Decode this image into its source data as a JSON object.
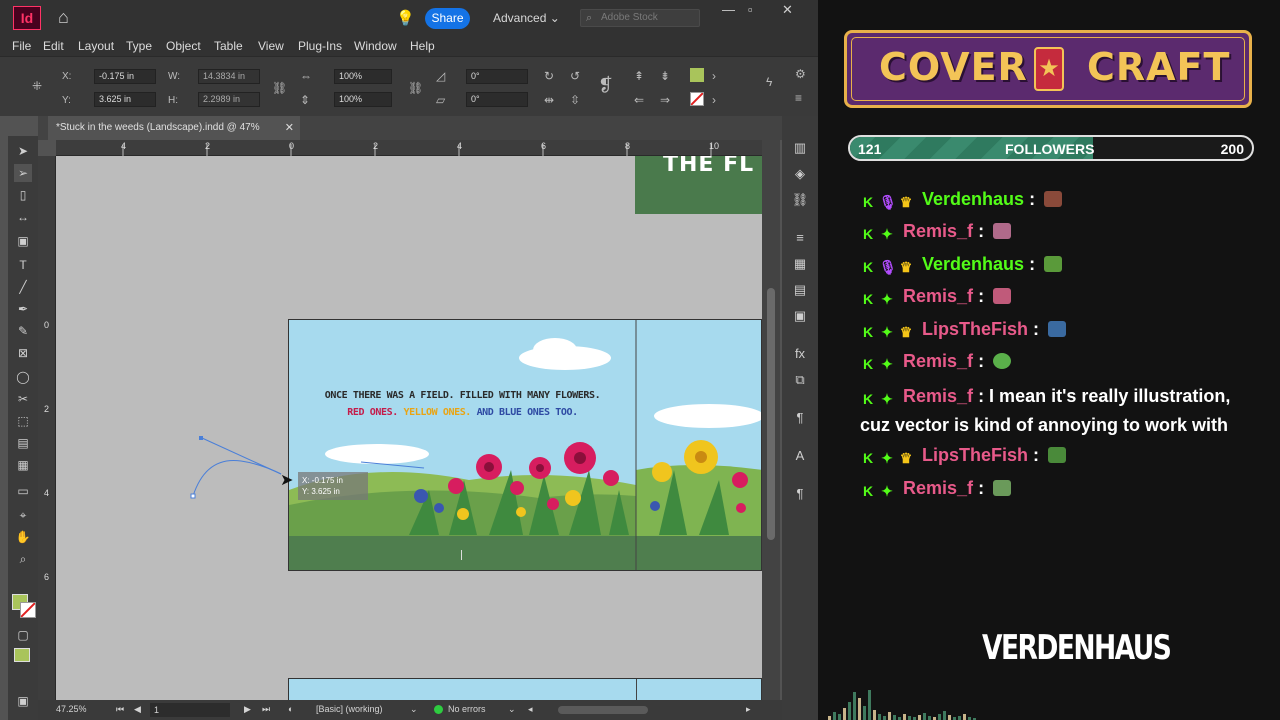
{
  "app": {
    "logo": "Id",
    "share_label": "Share",
    "workspace": "Advanced",
    "stock_placeholder": "Adobe Stock",
    "menu": [
      "File",
      "Edit",
      "Layout",
      "Type",
      "Object",
      "Table",
      "View",
      "Plug-Ins",
      "Window",
      "Help"
    ]
  },
  "control": {
    "x_label": "X:",
    "x_value": "-0.175 in",
    "y_label": "Y:",
    "y_value": "3.625 in",
    "w_label": "W:",
    "w_value": "14.3834 in",
    "h_label": "H:",
    "h_value": "2.2989 in",
    "scale_x": "100%",
    "scale_y": "100%",
    "rotate": "0°",
    "shear": "0°"
  },
  "document": {
    "tab_title": "*Stuck in the weeds (Landscape).indd @ 47%",
    "ruler_top": [
      "4",
      "2",
      "0",
      "2",
      "4",
      "6",
      "8",
      "10"
    ],
    "ruler_left": [
      "0",
      "2",
      "4",
      "6"
    ],
    "page_text_line1": "ONCE THERE WAS A FIELD. FILLED WITH MANY FLOWERS.",
    "page_red": "RED ONES.",
    "page_yellow": "YELLOW ONES.",
    "page_blue": "AND BLUE ONES TOO.",
    "cursor_x": "X: -0.175 in",
    "cursor_y": "Y: 3.625 in"
  },
  "status": {
    "zoom": "47.25%",
    "page": "1",
    "preflight_profile": "[Basic] (working)",
    "errors": "No errors"
  },
  "overlay": {
    "logo_left": "COVER",
    "logo_right": "CRAFT",
    "followers_current": "121",
    "followers_label": "FOLLOWERS",
    "followers_goal": "200",
    "followers_progress": 0.605,
    "brand": "VERDENHAUS",
    "colors": {
      "green_user": "#53fc18",
      "pink_user": "#e85a8a",
      "frame_gold": "#e8b14a",
      "frame_purple": "#5b2a6e"
    },
    "chat": [
      {
        "user": "Verdenhaus",
        "message": ":",
        "user_color": "#53fc18"
      },
      {
        "user": "Remis_f",
        "message": ":",
        "user_color": "#e85a8a"
      },
      {
        "user": "Verdenhaus",
        "message": ":",
        "user_color": "#53fc18"
      },
      {
        "user": "Remis_f",
        "message": ":",
        "user_color": "#e85a8a"
      },
      {
        "user": "LipsTheFish",
        "message": ":",
        "user_color": "#e85a8a"
      },
      {
        "user": "Remis_f",
        "message": ":",
        "user_color": "#e85a8a"
      },
      {
        "user": "Remis_f",
        "message": ": I mean it's really illustration, cuz vector is kind of annoying to work with",
        "user_color": "#e85a8a"
      },
      {
        "user": "LipsTheFish",
        "message": ":",
        "user_color": "#e85a8a"
      },
      {
        "user": "Remis_f",
        "message": ":",
        "user_color": "#e85a8a"
      }
    ]
  }
}
